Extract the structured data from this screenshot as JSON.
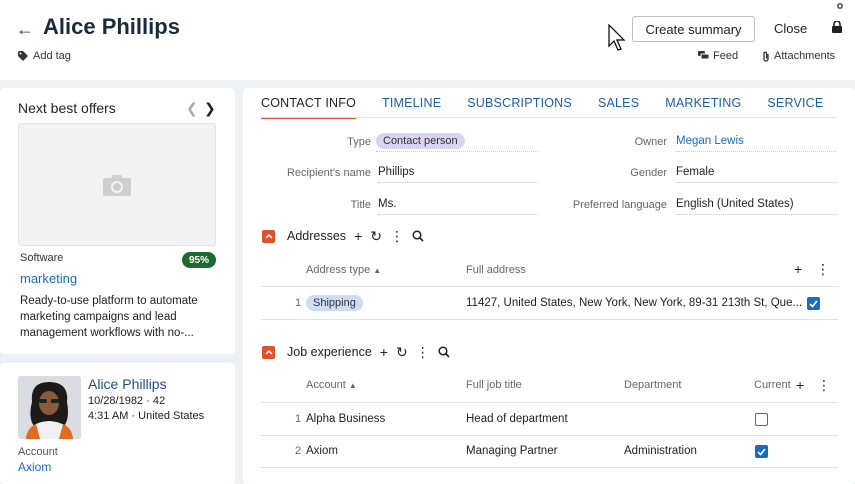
{
  "header": {
    "title": "Alice Phillips",
    "add_tag": "Add tag",
    "create_summary": "Create summary",
    "close": "Close",
    "feed": "Feed",
    "attachments": "Attachments"
  },
  "offers": {
    "title": "Next best offers",
    "category": "Software",
    "badge": "95%",
    "name": "marketing",
    "description": "Ready-to-use platform to automate marketing campaigns and lead management workflows with no-..."
  },
  "profile": {
    "name": "Alice Phillips",
    "meta1": "10/28/1982 · 42",
    "meta2": "4:31 AM · United States",
    "account_label": "Account",
    "account_value": "Axiom"
  },
  "tabs": [
    "CONTACT INFO",
    "TIMELINE",
    "SUBSCRIPTIONS",
    "SALES",
    "MARKETING",
    "SERVICE"
  ],
  "fields": {
    "type_label": "Type",
    "type_value": "Contact person",
    "recipient_label": "Recipient's name",
    "recipient_value": "Phillips",
    "title_label": "Title",
    "title_value": "Ms.",
    "owner_label": "Owner",
    "owner_value": "Megan Lewis",
    "gender_label": "Gender",
    "gender_value": "Female",
    "language_label": "Preferred language",
    "language_value": "English (United States)"
  },
  "addresses": {
    "title": "Addresses",
    "col_type": "Address type",
    "col_full": "Full address",
    "rows": [
      {
        "num": "1",
        "type": "Shipping",
        "full": "11427, United States, New York, New York, 89-31 213th St, Que...",
        "checked": true
      }
    ]
  },
  "jobs": {
    "title": "Job experience",
    "col_account": "Account",
    "col_title": "Full job title",
    "col_dept": "Department",
    "col_current": "Current",
    "rows": [
      {
        "num": "1",
        "account": "Alpha Business",
        "title": "Head of department",
        "dept": "",
        "current": false
      },
      {
        "num": "2",
        "account": "Axiom",
        "title": "Managing Partner",
        "dept": "Administration",
        "current": true
      }
    ]
  },
  "colors": {
    "accent": "#e0512b",
    "link": "#1b6bbf",
    "badge_green": "#1d6a2c"
  }
}
